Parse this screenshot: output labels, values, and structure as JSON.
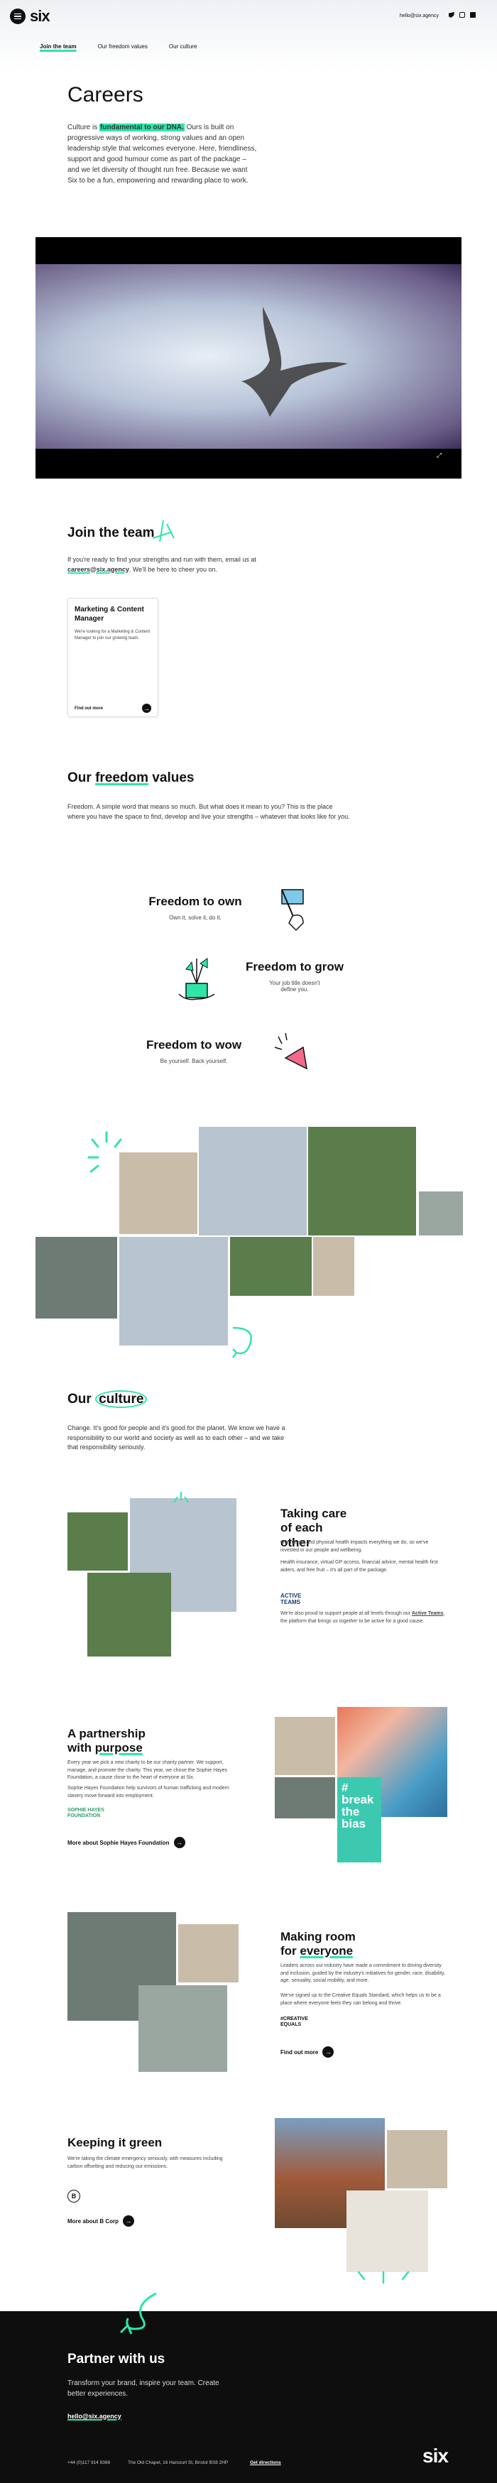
{
  "header": {
    "email": "hello@six.agency",
    "logo": "six",
    "nav": [
      "Join the team",
      "Our freedom values",
      "Our culture"
    ],
    "social_icons": [
      "twitter-icon",
      "instagram-icon",
      "linkedin-icon"
    ]
  },
  "hero": {
    "title": "Careers",
    "intro_before": "Culture is ",
    "intro_highlight": "fundamental to our DNA.",
    "intro_after": " Ours is built on progressive ways of working, strong values and an open leadership style that welcomes everyone. Here, friendliness, support and good humour come as part of the package – and we let diversity of thought run free. Because we want Six to be a fun, empowering and rewarding place to work."
  },
  "join": {
    "title": "Join the team",
    "body_before": "If you're ready to find your strengths and run with them, email us at ",
    "email": "careers@six.agency",
    "body_after": ". We'll be here to cheer you on.",
    "card_title": "Marketing & Content Manager",
    "card_text": "We're looking for a Marketing & Content Manager to join our growing team.",
    "card_link": "Find out more"
  },
  "values": {
    "title_before": "Our ",
    "title_highlight": "freedom",
    "title_after": " values",
    "body": "Freedom. A simple word that means so much. But what does it mean to you? This is the place where you have the space to find, develop and live your strengths – whatever that looks like for you.",
    "items": [
      {
        "title": "Freedom to own",
        "text": "Own it, solve it, do it."
      },
      {
        "title": "Freedom to grow",
        "text": "Your job title doesn't define you."
      },
      {
        "title": "Freedom to wow",
        "text": "Be yourself. Back yourself."
      }
    ]
  },
  "culture": {
    "title_before": "Our ",
    "title_highlight": "culture",
    "body": "Change. It's good for people and it's good for the planet. We know we have a responsibility to our world and society as well as to each other – and we take that responsibility seriously."
  },
  "care": {
    "title": "Taking care of each other",
    "p1": "Our mental and physical health impacts everything we do, so we've invested in our people and wellbeing.",
    "p2": "Health insurance, virtual GP access, financial advice, mental health first aiders, and free fruit – it's all part of the package.",
    "logo": "ACTIVE TEAMS",
    "p3": "We're also proud to support people at all levels through our Active Teams, the platform that brings us together to be active for a good cause.",
    "p3_link": "Active Teams"
  },
  "partnership": {
    "title_line1": "A partnership",
    "title_before": "with ",
    "title_highlight": "purpose",
    "p1": "Every year we pick a new charity to be our charity partner. We support, manage, and promote the charity. This year, we chose the Sophie Hayes Foundation, a cause close to the heart of everyone at Six.",
    "p2": "Sophie Hayes Foundation help survivors of human trafficking and modern slavery move forward into employment.",
    "logo": "SOPHIE HAYES FOUNDATION",
    "link": "More about Sophie Hayes Foundation",
    "art_text": "# break the bias"
  },
  "room": {
    "title_line1": "Making room",
    "title_before": "for ",
    "title_highlight": "everyone",
    "p1": "Leaders across our industry have made a commitment to driving diversity and inclusion, guided by the industry's initiatives for gender, race, disability, age, sexuality, social mobility, and more.",
    "p2": "We've signed up to the Creative Equals Standard, which helps us to be a place where everyone feels they can belong and thrive.",
    "logo": "#CREATIVE EQUALS",
    "link": "Find out more"
  },
  "green": {
    "title": "Keeping it green",
    "p1": "We're taking the climate emergency seriously, with measures including carbon offsetting and reducing our emissions.",
    "logo": "B",
    "link": "More about B Corp"
  },
  "footer": {
    "title": "Partner with us",
    "tagline": "Transform your brand, inspire your team. Create better experiences.",
    "email": "hello@six.agency",
    "phone": "+44 (0)117 914 9368",
    "address": "The Old Chapel, 16 Harcourt St, Bristol BS8 2HP",
    "directions": "Get directions",
    "logo": "six"
  },
  "colors": {
    "accent": "#2ee6a8",
    "dark": "#111111",
    "pink": "#f06b8a",
    "blue": "#7fc8e8"
  }
}
